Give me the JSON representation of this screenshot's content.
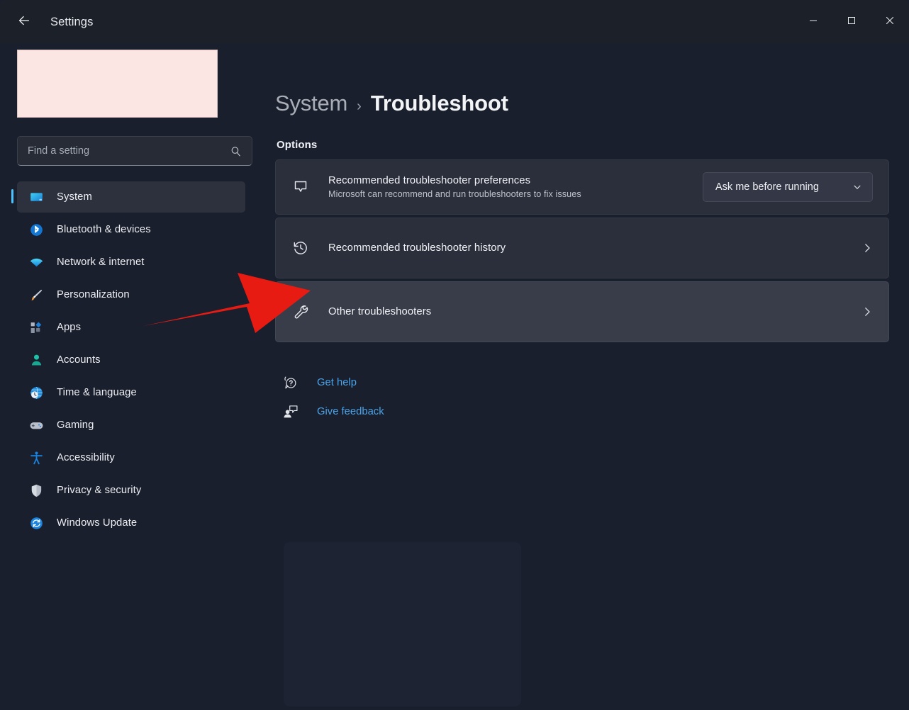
{
  "window": {
    "app_title": "Settings",
    "back_icon": "arrow-left-icon",
    "controls": {
      "minimize": "minimize-icon",
      "maximize": "maximize-icon",
      "close": "close-icon"
    }
  },
  "sidebar": {
    "search": {
      "placeholder": "Find a setting",
      "value": "",
      "icon": "search-icon"
    },
    "items": [
      {
        "label": "System",
        "icon": "monitor-icon",
        "active": true
      },
      {
        "label": "Bluetooth & devices",
        "icon": "bluetooth-icon",
        "active": false
      },
      {
        "label": "Network & internet",
        "icon": "wifi-icon",
        "active": false
      },
      {
        "label": "Personalization",
        "icon": "paintbrush-icon",
        "active": false
      },
      {
        "label": "Apps",
        "icon": "apps-icon",
        "active": false
      },
      {
        "label": "Accounts",
        "icon": "person-icon",
        "active": false
      },
      {
        "label": "Time & language",
        "icon": "clock-globe-icon",
        "active": false
      },
      {
        "label": "Gaming",
        "icon": "gamepad-icon",
        "active": false
      },
      {
        "label": "Accessibility",
        "icon": "accessibility-icon",
        "active": false
      },
      {
        "label": "Privacy & security",
        "icon": "shield-icon",
        "active": false
      },
      {
        "label": "Windows Update",
        "icon": "update-icon",
        "active": false
      }
    ]
  },
  "main": {
    "breadcrumb": {
      "parent": "System",
      "separator": "›",
      "current": "Troubleshoot"
    },
    "section_title": "Options",
    "cards": [
      {
        "title": "Recommended troubleshooter preferences",
        "subtitle": "Microsoft can recommend and run troubleshooters to fix issues",
        "icon": "chat-bubble-icon",
        "control": "dropdown",
        "dropdown_value": "Ask me before running"
      },
      {
        "title": "Recommended troubleshooter history",
        "subtitle": "",
        "icon": "history-icon",
        "control": "chevron",
        "dropdown_value": ""
      },
      {
        "title": "Other troubleshooters",
        "subtitle": "",
        "icon": "wrench-icon",
        "control": "chevron",
        "dropdown_value": ""
      }
    ],
    "links": [
      {
        "label": "Get help",
        "icon": "help-bubble-icon"
      },
      {
        "label": "Give feedback",
        "icon": "feedback-person-icon"
      }
    ]
  },
  "annotation": {
    "type": "arrow",
    "color": "#e81b13",
    "points_to": "Other troubleshooters"
  },
  "colors": {
    "accent": "#4cc2ff",
    "link": "#4aa3e8",
    "window_bg": "#1a1f2e",
    "titlebar_bg": "#1c2029",
    "card_bg": "#2b2f3c",
    "card_hover_bg": "#393d4a",
    "redaction": "#fce6e3",
    "annotation_red": "#e81b13"
  }
}
